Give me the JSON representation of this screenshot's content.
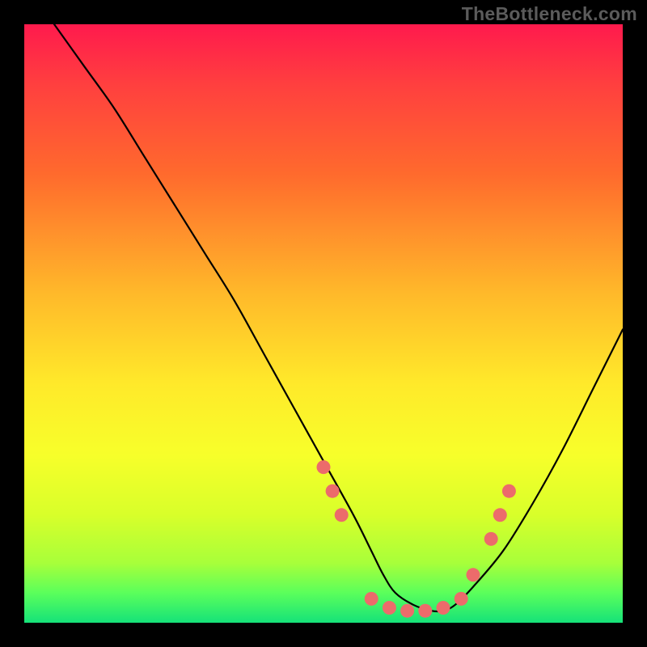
{
  "watermark": "TheBottleneck.com",
  "chart_data": {
    "type": "line",
    "title": "",
    "xlabel": "",
    "ylabel": "",
    "xlim": [
      0,
      100
    ],
    "ylim": [
      0,
      100
    ],
    "series": [
      {
        "name": "curve",
        "x": [
          5,
          10,
          15,
          20,
          25,
          30,
          35,
          40,
          45,
          50,
          55,
          58,
          60,
          62,
          65,
          68,
          70,
          72,
          75,
          80,
          85,
          90,
          95,
          100
        ],
        "y": [
          100,
          93,
          86,
          78,
          70,
          62,
          54,
          45,
          36,
          27,
          18,
          12,
          8,
          5,
          3,
          2,
          2,
          3,
          6,
          12,
          20,
          29,
          39,
          49
        ]
      }
    ],
    "markers": {
      "name": "highlight-dots",
      "color": "#ec6b6b",
      "x": [
        50,
        51.5,
        53,
        58,
        61,
        64,
        67,
        70,
        73,
        75,
        78,
        79.5,
        81
      ],
      "y": [
        26,
        22,
        18,
        4,
        2.5,
        2,
        2,
        2.5,
        4,
        8,
        14,
        18,
        22
      ]
    }
  }
}
